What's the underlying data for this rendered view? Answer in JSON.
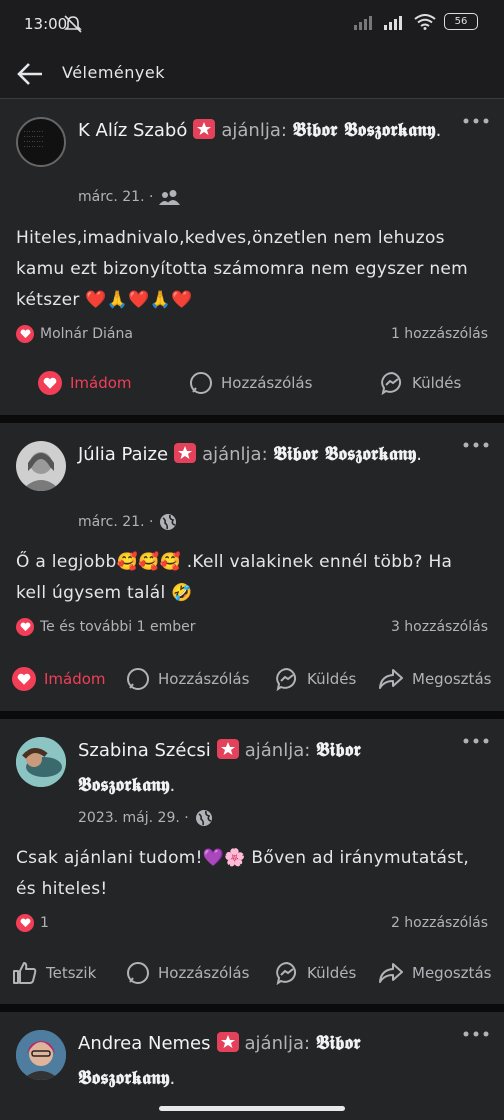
{
  "status": {
    "time": "13:00",
    "battery": "56"
  },
  "appbar": {
    "title": "Vélemények"
  },
  "posts": [
    {
      "author": "K Alíz Szabó",
      "verb": "ajánlja:",
      "page": "𝕭𝖎𝖇𝖔𝖗 𝕭𝖔𝖘𝖟𝖔𝖗𝖐𝖆𝖓𝖞",
      "date": "márc. 21. ·",
      "audience": "friends-icon",
      "text": "Hiteles,imadnivalo,kedves,önzetlen nem lehuzos kamu ezt bizonyította számomra nem egyszer nem kétszer ❤️🙏❤️🙏❤️",
      "reactions": "Molnár Diána",
      "comments": "1 hozzászólás",
      "actions": [
        "Imádom",
        "Hozzászólás",
        "Küldés"
      ]
    },
    {
      "author": "Júlia Paize",
      "verb": "ajánlja:",
      "page": "𝕭𝖎𝖇𝖔𝖗 𝕭𝖔𝖘𝖟𝖔𝖗𝖐𝖆𝖓𝖞",
      "date": "márc. 21. ·",
      "audience": "globe-icon",
      "text": "Ő a legjobb🥰🥰🥰 .Kell valakinek ennél több? Ha kell úgysem talál 🤣",
      "reactions": "Te és további 1 ember",
      "comments": "3 hozzászólás",
      "actions": [
        "Imádom",
        "Hozzászólás",
        "Küldés",
        "Megosztás"
      ]
    },
    {
      "author": "Szabina Szécsi",
      "verb": "ajánlja:",
      "page": "𝕭𝖎𝖇𝖔𝖗 𝕭𝖔𝖘𝖟𝖔𝖗𝖐𝖆𝖓𝖞",
      "date": "2023. máj. 29. ·",
      "audience": "globe-icon",
      "text": "Csak ajánlani tudom!💜🌸 Bőven ad iránymutatást, és hiteles!",
      "reactions": "1",
      "comments": "2 hozzászólás",
      "actions": [
        "Tetszik",
        "Hozzászólás",
        "Küldés",
        "Megosztás"
      ]
    },
    {
      "author": "Andrea Nemes",
      "verb": "ajánlja:",
      "page": "𝕭𝖎𝖇𝖔𝖗 𝕭𝖔𝖘𝖟𝖔𝖗𝖐𝖆𝖓𝖞"
    }
  ],
  "colors": {
    "background": "#0b0b0c",
    "card": "#242526",
    "accent_love": "#f33e58",
    "badge": "#e4415b"
  }
}
